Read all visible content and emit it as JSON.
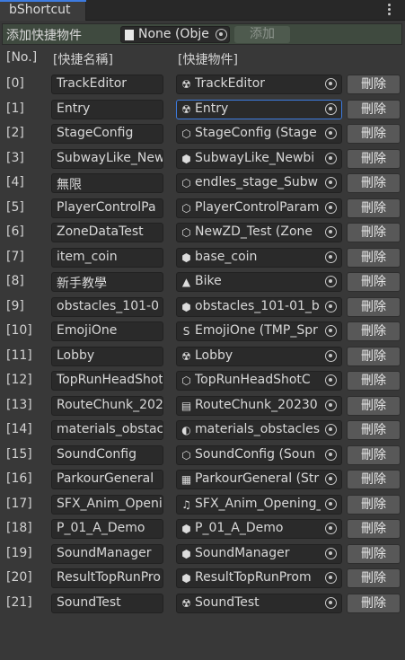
{
  "window": {
    "tab_title": "bShortcut"
  },
  "add_bar": {
    "label": "添加快捷物件",
    "object_field_value": "None (Obje",
    "add_button": "添加"
  },
  "headers": {
    "index": "[No.]",
    "name": "[快捷名稱]",
    "object": "[快捷物件]"
  },
  "delete_label": "刪除",
  "rows": [
    {
      "index": "[0]",
      "name": "TrackEditor",
      "object": "TrackEditor",
      "icon": "unity-scene-icon"
    },
    {
      "index": "[1]",
      "name": "Entry",
      "object": "Entry",
      "icon": "unity-scene-icon"
    },
    {
      "index": "[2]",
      "name": "StageConfig",
      "object": "StageConfig (Stage",
      "icon": "scriptable-object-icon"
    },
    {
      "index": "[3]",
      "name": "SubwayLike_New",
      "object": "SubwayLike_Newbi",
      "icon": "prefab-cube-icon"
    },
    {
      "index": "[4]",
      "name": "無限",
      "object": "endles_stage_Subw",
      "icon": "scriptable-object-icon"
    },
    {
      "index": "[5]",
      "name": "PlayerControlPa",
      "object": "PlayerControlParam",
      "icon": "scriptable-object-icon"
    },
    {
      "index": "[6]",
      "name": "ZoneDataTest",
      "object": "NewZD_Test (Zone",
      "icon": "scriptable-object-icon"
    },
    {
      "index": "[7]",
      "name": "item_coin",
      "object": "base_coin",
      "icon": "prefab-cube-icon"
    },
    {
      "index": "[8]",
      "name": "新手教學",
      "object": "Bike",
      "icon": "sprite-icon"
    },
    {
      "index": "[9]",
      "name": "obstacles_101-0",
      "object": "obstacles_101-01_b",
      "icon": "prefab-cube-icon"
    },
    {
      "index": "[10]",
      "name": "EmojiOne",
      "object": "EmojiOne (TMP_Spr",
      "icon": "tmp-sprite-icon"
    },
    {
      "index": "[11]",
      "name": "Lobby",
      "object": "Lobby",
      "icon": "unity-scene-icon"
    },
    {
      "index": "[12]",
      "name": "TopRunHeadShot",
      "object": "TopRunHeadShotC",
      "icon": "scriptable-object-icon"
    },
    {
      "index": "[13]",
      "name": "RouteChunk_202",
      "object": "RouteChunk_20230",
      "icon": "document-icon"
    },
    {
      "index": "[14]",
      "name": "materials_obstac",
      "object": "materials_obstacles",
      "icon": "material-icon"
    },
    {
      "index": "[15]",
      "name": "SoundConfig",
      "object": "SoundConfig (Soun",
      "icon": "scriptable-object-icon"
    },
    {
      "index": "[16]",
      "name": "ParkourGeneral",
      "object": "ParkourGeneral (Str",
      "icon": "string-table-icon"
    },
    {
      "index": "[17]",
      "name": "SFX_Anim_Openi",
      "object": "SFX_Anim_Opening_",
      "icon": "audio-icon"
    },
    {
      "index": "[18]",
      "name": "P_01_A_Demo",
      "object": "P_01_A_Demo",
      "icon": "prefab-cube-icon"
    },
    {
      "index": "[19]",
      "name": "SoundManager",
      "object": "SoundManager",
      "icon": "prefab-cube-icon"
    },
    {
      "index": "[20]",
      "name": "ResultTopRunPro",
      "object": "ResultTopRunProm",
      "icon": "prefab-cube-icon"
    },
    {
      "index": "[21]",
      "name": "SoundTest",
      "object": "SoundTest",
      "icon": "unity-scene-icon"
    }
  ],
  "selected_object_row": "[1]",
  "colors": {
    "accent": "#3d7be0",
    "background": "#383838",
    "field": "#2a2a2a",
    "button": "#585858"
  }
}
